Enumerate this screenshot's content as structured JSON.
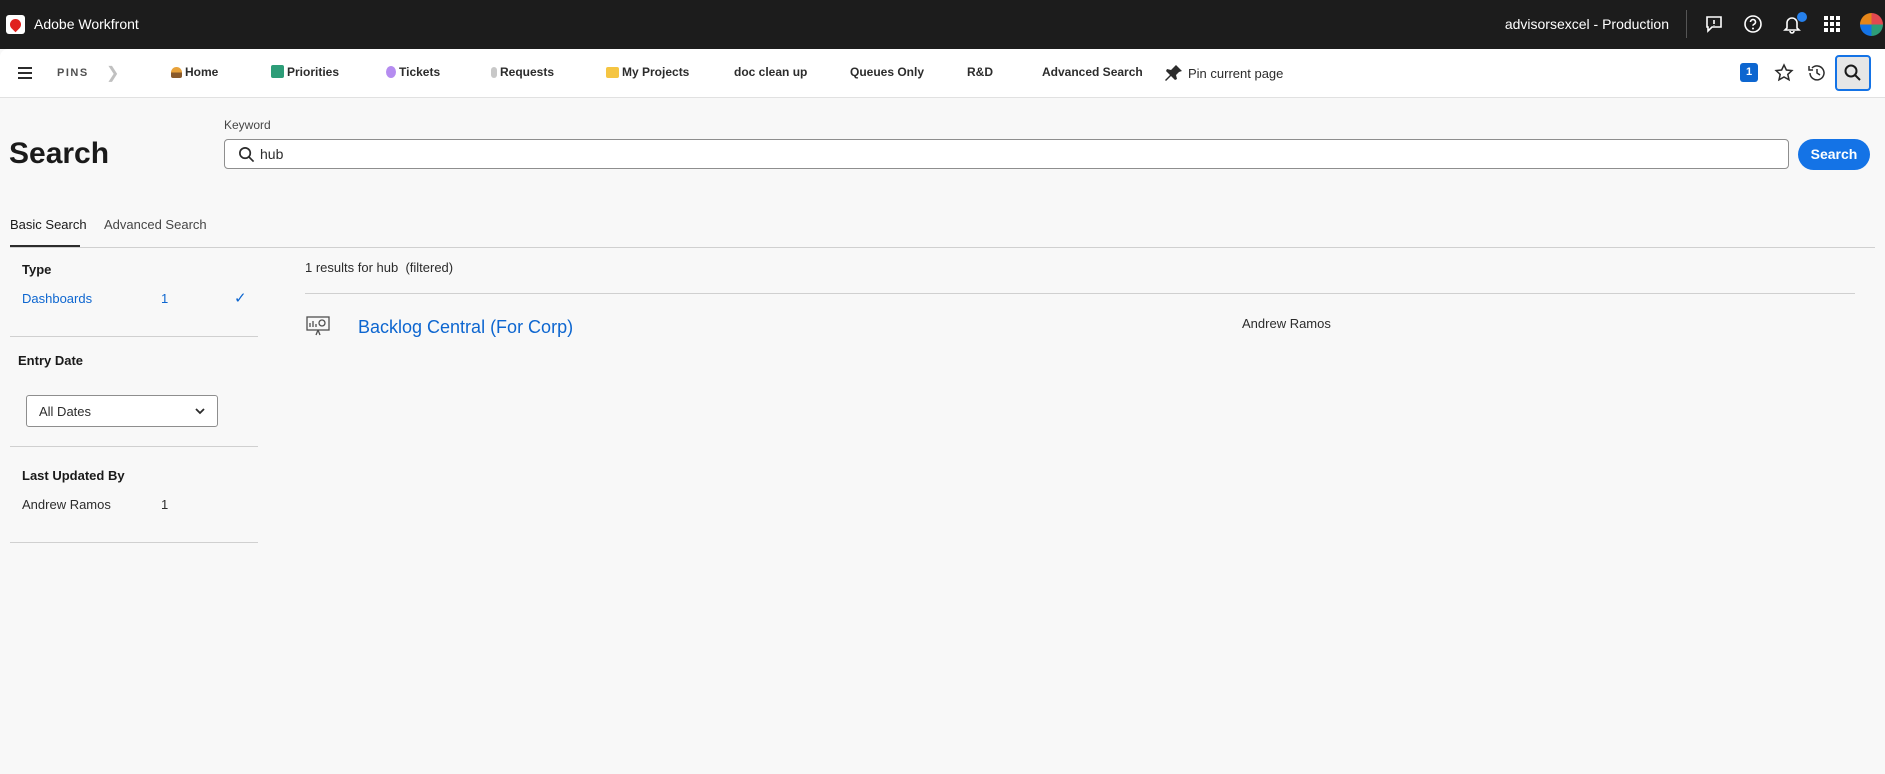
{
  "topbar": {
    "app_name": "Adobe Workfront",
    "environment": "advisorsexcel - Production",
    "icons": [
      "feedback-icon",
      "help-icon",
      "bell-icon",
      "apps-grid-icon",
      "avatar"
    ]
  },
  "pins": {
    "label": "PINS",
    "items": [
      {
        "label": "Home",
        "icon": "home-emoji-icon"
      },
      {
        "label": "Priorities",
        "icon": "checkbox-emoji-icon"
      },
      {
        "label": "Tickets",
        "icon": "tickets-emoji-icon"
      },
      {
        "label": "Requests",
        "icon": "requests-emoji-icon"
      },
      {
        "label": "My Projects",
        "icon": "folder-emoji-icon"
      },
      {
        "label": "doc clean up"
      },
      {
        "label": "Queues Only"
      },
      {
        "label": "R&D"
      },
      {
        "label": "Advanced Search"
      }
    ],
    "pin_current": "Pin current page",
    "badge_count": "1"
  },
  "page": {
    "title": "Search",
    "keyword_label": "Keyword",
    "keyword_value": "hub",
    "search_button": "Search"
  },
  "tabs": [
    {
      "label": "Basic Search",
      "active": true
    },
    {
      "label": "Advanced Search",
      "active": false
    }
  ],
  "facets": {
    "type": {
      "title": "Type",
      "items": [
        {
          "label": "Dashboards",
          "count": "1",
          "checked": true
        }
      ]
    },
    "entry_date": {
      "title": "Entry Date",
      "selected": "All Dates"
    },
    "last_updated_by": {
      "title": "Last Updated By",
      "items": [
        {
          "label": "Andrew Ramos",
          "count": "1"
        }
      ]
    }
  },
  "results": {
    "summary": "1 results for hub  (filtered)",
    "items": [
      {
        "title": "Backlog Central (For Corp)",
        "owner": "Andrew Ramos",
        "icon": "dashboard-icon"
      }
    ]
  },
  "colors": {
    "accent": "#1473e6",
    "link": "#0d66d0",
    "topbar": "#1c1c1c"
  }
}
